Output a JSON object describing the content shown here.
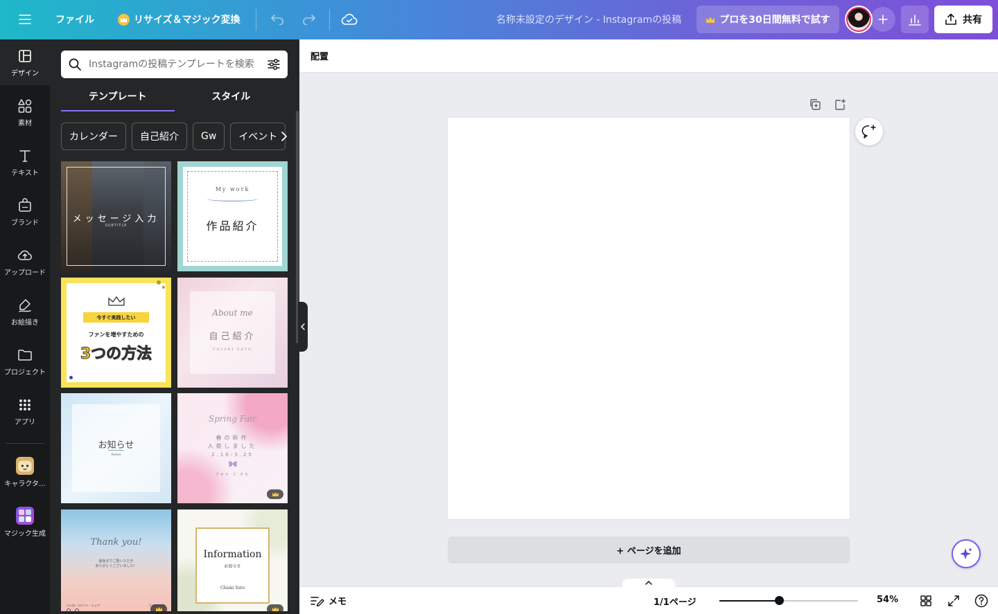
{
  "topbar": {
    "file_label": "ファイル",
    "resize_label": "リサイズ＆マジック変換",
    "doc_title": "名称未設定のデザイン - Instagramの投稿",
    "pro_trial_label": "プロを30日間無料で試す",
    "share_label": "共有",
    "gradient_colors": [
      "#1fb8c9",
      "#7d4fd8"
    ]
  },
  "rail": {
    "items": [
      {
        "label": "デザイン",
        "icon": "layout-icon"
      },
      {
        "label": "素材",
        "icon": "shapes-icon"
      },
      {
        "label": "テキスト",
        "icon": "text-icon"
      },
      {
        "label": "ブランド",
        "icon": "brand-icon"
      },
      {
        "label": "アップロード",
        "icon": "upload-icon"
      },
      {
        "label": "お絵描き",
        "icon": "draw-icon"
      },
      {
        "label": "プロジェクト",
        "icon": "folder-icon"
      },
      {
        "label": "アプリ",
        "icon": "apps-icon"
      },
      {
        "label": "キャラクタ...",
        "icon": "character-app-icon"
      },
      {
        "label": "マジック生成",
        "icon": "magic-media-icon"
      }
    ]
  },
  "panel": {
    "search_placeholder": "Instagramの投稿テンプレートを検索",
    "tabs": [
      {
        "label": "テンプレート",
        "active": true
      },
      {
        "label": "スタイル",
        "active": false
      }
    ],
    "chips": [
      "カレンダー",
      "自己紹介",
      "Gw",
      "イベント"
    ],
    "templates": [
      {
        "title": "メッセージ入力",
        "sub": "SUBTITLE",
        "pro": false
      },
      {
        "kicker": "My work",
        "title": "作品紹介",
        "pro": false
      },
      {
        "banner": "今すぐ実践したい",
        "line": "ファンを増やすための",
        "title": "3つの方法",
        "pro": false
      },
      {
        "kicker": "About me",
        "title": "自己紹介",
        "sub": "CHIAKI SATO",
        "pro": false
      },
      {
        "title": "お知らせ",
        "sub": "News",
        "pro": false
      },
      {
        "kicker": "Spring Fair",
        "line1": "春の新作",
        "line2": "入荷しました",
        "date": "2.10-3.25",
        "name": "アキナ ミ そら",
        "pro": true
      },
      {
        "kicker": "Thank you!",
        "line1": "最後までご覧いただき",
        "line2": "ありがとうございました！",
        "footer_left": "いいね・コメント・シェア",
        "footer_right": "ブックマーク",
        "pro": true
      },
      {
        "title": "Information",
        "sub": "お知らせ",
        "name": "Chiaki Sato",
        "pro": true
      }
    ]
  },
  "toolbar": {
    "position_label": "配置"
  },
  "canvas": {
    "add_page_label": "+ ページを追加"
  },
  "bottombar": {
    "memo_label": "メモ",
    "page_indicator": "1/1ページ",
    "zoom_label": "54%",
    "zoom_fraction": 0.43
  }
}
